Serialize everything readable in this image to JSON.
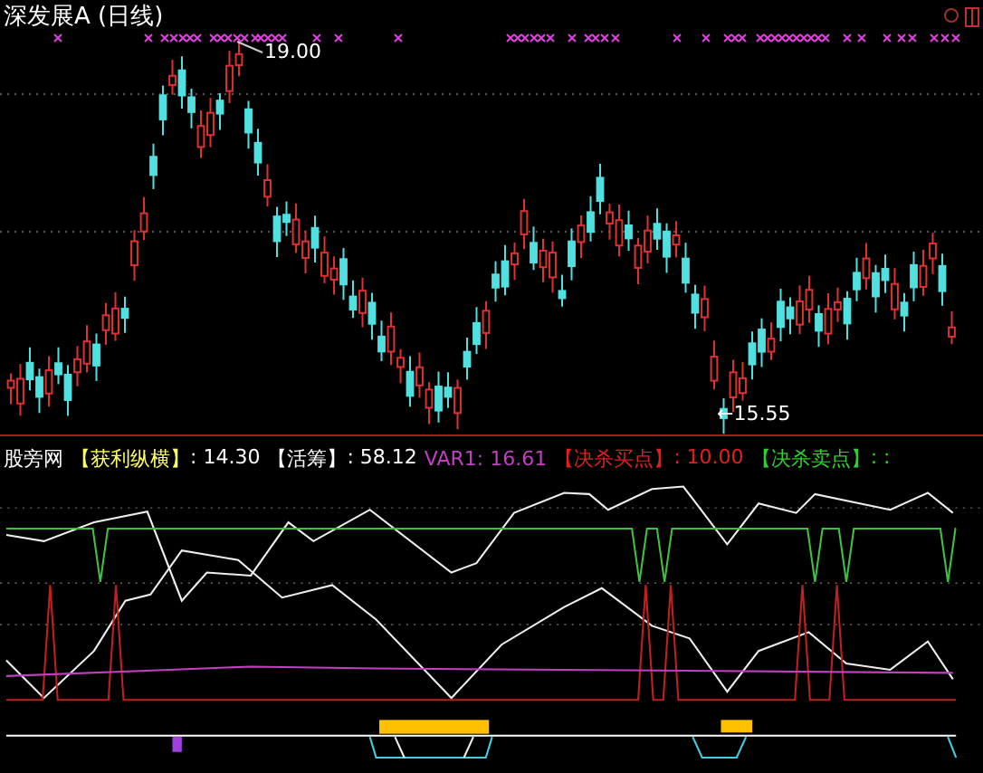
{
  "window": {
    "title": "深发展A (日线)"
  },
  "price_chart": {
    "high_label": "19.00",
    "low_label": "←15.55"
  },
  "indicator": {
    "name": "股旁网",
    "fields": [
      {
        "label": "【获利纵横】",
        "value": ": 14.30",
        "color": "#ffff66"
      },
      {
        "label": "【活筹】",
        "value": ": 58.12",
        "color": "#ffffff"
      },
      {
        "label": "VAR1",
        "value": ": 16.61",
        "color": "#c040c0"
      },
      {
        "label": "【决杀买点】",
        "value": ": 10.00",
        "color": "#e02020"
      },
      {
        "label": "【决杀卖点】",
        "value": ": :",
        "color": "#30d030"
      }
    ]
  }
}
